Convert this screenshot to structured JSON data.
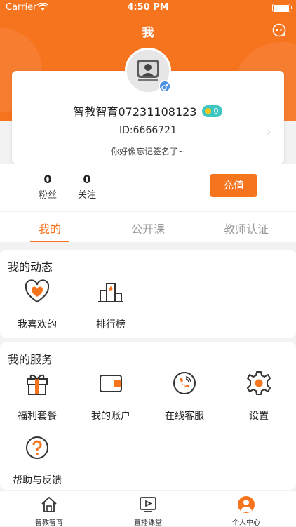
{
  "status_bar": {
    "carrier": "Carrier",
    "time": "4:50 PM"
  },
  "header": {
    "title": "我",
    "message_icon": "chat-bubble-icon"
  },
  "profile": {
    "name": "智教智育07231108123",
    "coins": "0",
    "id_text": "ID:6666721",
    "signature": "你好像忘记签名了~",
    "gender_icon": "male-icon"
  },
  "stats": {
    "fans_count": "0",
    "fans_label": "粉丝",
    "follow_count": "0",
    "follow_label": "关注",
    "recharge_label": "充值"
  },
  "tabs": [
    {
      "label": "我的",
      "active": true
    },
    {
      "label": "公开课",
      "active": false
    },
    {
      "label": "教师认证",
      "active": false
    }
  ],
  "dynamics": {
    "title": "我的动态",
    "items": [
      {
        "label": "我喜欢的",
        "icon": "heart-icon"
      },
      {
        "label": "排行榜",
        "icon": "ranking-icon"
      }
    ]
  },
  "services": {
    "title": "我的服务",
    "items": [
      {
        "label": "福利套餐",
        "icon": "gift-icon"
      },
      {
        "label": "我的账户",
        "icon": "wallet-icon"
      },
      {
        "label": "在线客服",
        "icon": "phone-icon"
      },
      {
        "label": "设置",
        "icon": "gear-icon"
      },
      {
        "label": "帮助与反馈",
        "icon": "help-icon"
      }
    ]
  },
  "bottom_nav": [
    {
      "label": "智教智育",
      "icon": "home-icon"
    },
    {
      "label": "直播课堂",
      "icon": "video-icon"
    },
    {
      "label": "个人中心",
      "icon": "profile-icon",
      "active": true
    }
  ],
  "colors": {
    "accent": "#f7741f",
    "coin_badge": "#3dc6c2",
    "gender": "#4a90e2"
  }
}
